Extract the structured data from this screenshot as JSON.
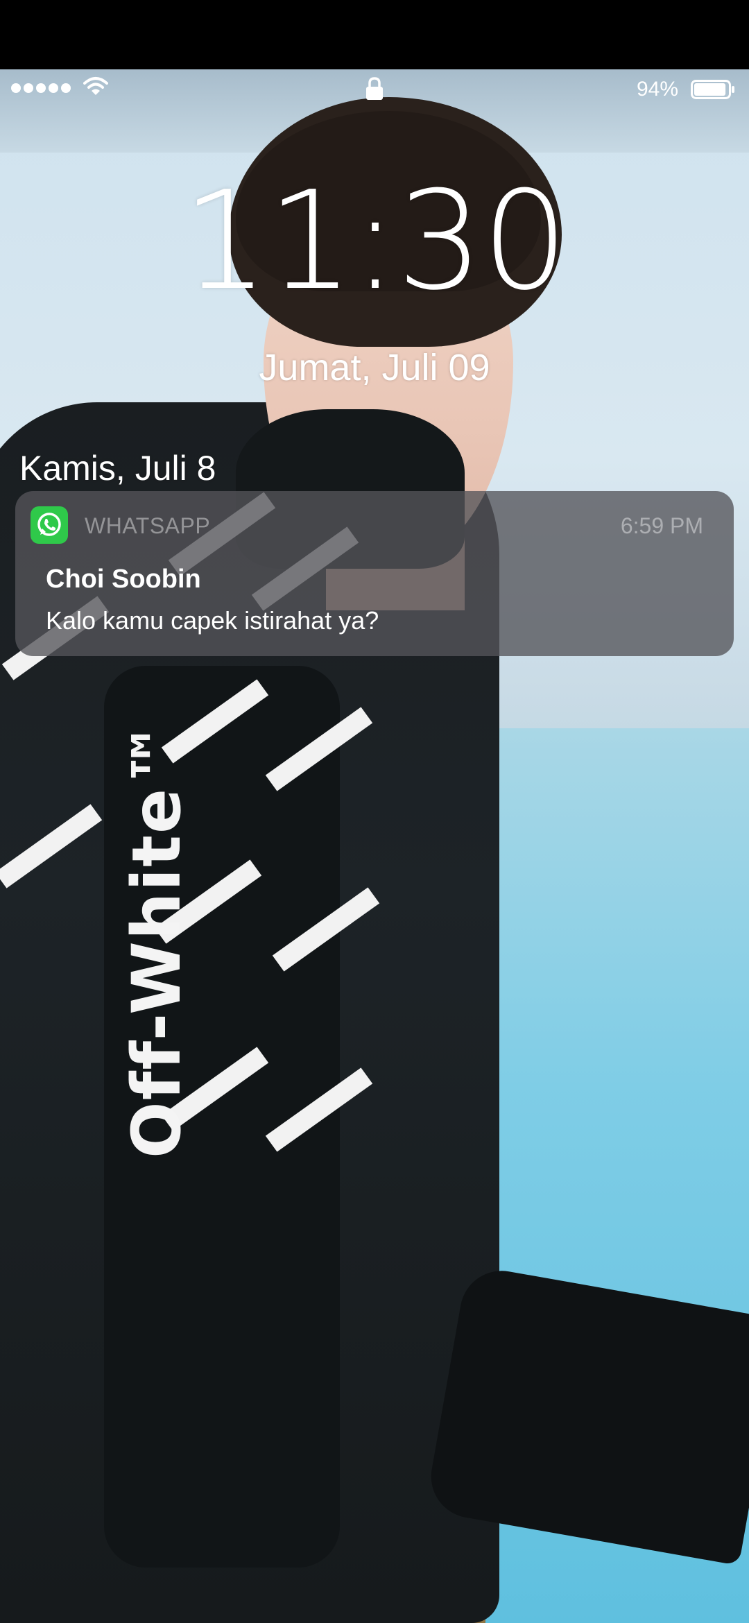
{
  "status_bar": {
    "signal_dots": 5,
    "battery_percent": "94%",
    "battery_level": 0.94,
    "icons": [
      "signal-dots-icon",
      "wifi-icon",
      "lock-icon",
      "battery-icon"
    ]
  },
  "clock": {
    "time": "11:30",
    "date": "Jumat, Juli 09"
  },
  "notifications": {
    "section_header": "Kamis, Juli 8",
    "items": [
      {
        "app_icon": "whatsapp-icon",
        "app_name": "WHATSAPP",
        "time": "6:59 PM",
        "sender": "Choi Soobin",
        "message": "Kalo kamu capek istirahat ya?"
      }
    ]
  },
  "wallpaper": {
    "brand_text": "Off-White™"
  },
  "colors": {
    "whatsapp_green": "#2fc94a",
    "card_background": "#54545a",
    "text_primary": "#ffffff"
  }
}
